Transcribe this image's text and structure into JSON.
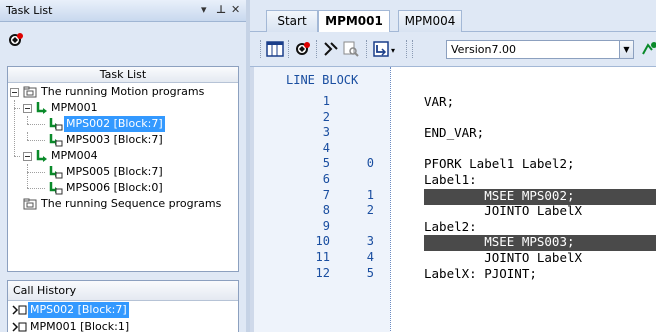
{
  "left_panel": {
    "title": "Task List",
    "controls": [
      "▾",
      "ᴨ",
      "✕"
    ],
    "tree_header": "Task List",
    "tree": [
      {
        "label": "The running Motion programs",
        "level": 0,
        "kind": "folder",
        "expanded": true
      },
      {
        "label": "MPM001",
        "level": 1,
        "kind": "program",
        "expanded": true
      },
      {
        "label": "MPS002 [Block:7]",
        "level": 2,
        "kind": "sub",
        "selected": true
      },
      {
        "label": "MPS003 [Block:7]",
        "level": 2,
        "kind": "sub"
      },
      {
        "label": "MPM004",
        "level": 1,
        "kind": "program",
        "expanded": true
      },
      {
        "label": "MPS005 [Block:7]",
        "level": 2,
        "kind": "sub"
      },
      {
        "label": "MPS006 [Block:0]",
        "level": 2,
        "kind": "sub"
      },
      {
        "label": "The running Sequence programs",
        "level": 0,
        "kind": "folder"
      }
    ],
    "history_title": "Call History",
    "history": [
      {
        "label": "MPS002 [Block:7]",
        "selected": true
      },
      {
        "label": "MPM001 [Block:1]"
      }
    ]
  },
  "tabs": [
    "Start",
    "MPM001",
    "MPM004"
  ],
  "active_tab": "MPM001",
  "toolbar": {
    "version_value": "Version7.00"
  },
  "editor": {
    "header": "LINE  BLOCK",
    "lines": [
      {
        "n": "1",
        "b": "",
        "code": "VAR;"
      },
      {
        "n": "2",
        "b": "",
        "code": ""
      },
      {
        "n": "3",
        "b": "",
        "code": "END_VAR;"
      },
      {
        "n": "4",
        "b": "",
        "code": ""
      },
      {
        "n": "5",
        "b": "0",
        "code": "PFORK Label1 Label2;"
      },
      {
        "n": "6",
        "b": "",
        "code": "Label1:"
      },
      {
        "n": "7",
        "b": "1",
        "code": "        MSEE MPS002;",
        "highlight": true
      },
      {
        "n": "8",
        "b": "2",
        "code": "        JOINTO LabelX"
      },
      {
        "n": "9",
        "b": "",
        "code": "Label2:"
      },
      {
        "n": "10",
        "b": "3",
        "code": "        MSEE MPS003;",
        "highlight": true
      },
      {
        "n": "11",
        "b": "4",
        "code": "        JOINTO LabelX"
      },
      {
        "n": "12",
        "b": "5",
        "code": "LabelX: PJOINT;"
      }
    ]
  }
}
